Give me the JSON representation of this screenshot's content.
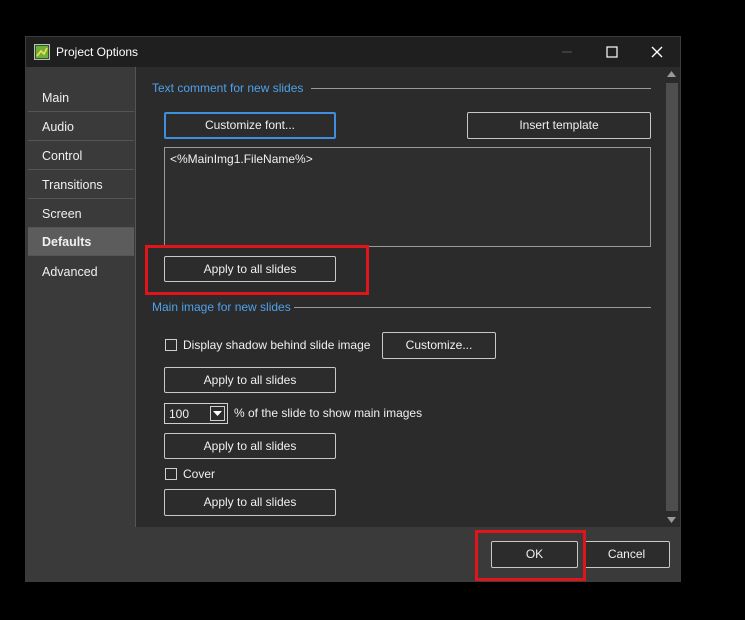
{
  "window": {
    "title": "Project Options",
    "minimize_glyph": "—",
    "maximize_glyph": "☐",
    "close_glyph": "✕"
  },
  "sidebar": {
    "items": [
      {
        "label": "Main"
      },
      {
        "label": "Audio"
      },
      {
        "label": "Control"
      },
      {
        "label": "Transitions"
      },
      {
        "label": "Screen"
      },
      {
        "label": "Defaults",
        "selected": true
      },
      {
        "label": "Advanced"
      }
    ]
  },
  "text_section": {
    "heading": "Text comment for new slides",
    "customize_font_label": "Customize font...",
    "insert_template_label": "Insert template",
    "comment_value": "<%MainImg1.FileName%>",
    "apply_label": "Apply to all slides"
  },
  "image_section": {
    "heading": "Main image for new slides",
    "shadow_label": "Display shadow behind slide image",
    "shadow_checked": false,
    "customize_label": "Customize...",
    "apply_label_1": "Apply to all slides",
    "percent_value": "100",
    "percent_label": "% of the slide to show main images",
    "apply_label_2": "Apply to all slides",
    "cover_label": "Cover",
    "cover_checked": false,
    "apply_label_3": "Apply to all slides"
  },
  "footer": {
    "ok_label": "OK",
    "cancel_label": "Cancel"
  },
  "colors": {
    "accent": "#4ea1ea",
    "highlight": "#e0151c",
    "window_bg": "#2b2b2b",
    "sidebar_bg": "#3a3a3a"
  },
  "icons": [
    "app-icon",
    "minimize-icon",
    "maximize-icon",
    "close-icon",
    "chevron-down-icon",
    "scroll-up-icon",
    "scroll-down-icon"
  ]
}
